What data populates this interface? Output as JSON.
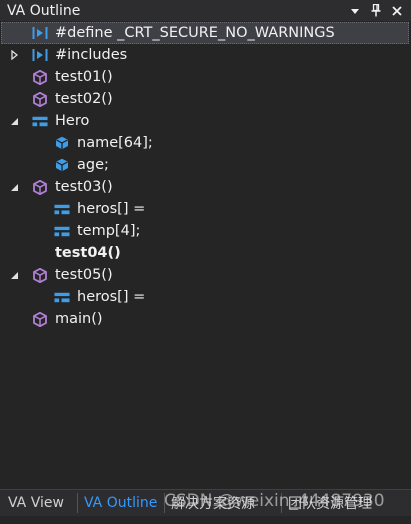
{
  "window": {
    "title": "VA Outline",
    "controls": [
      "dropdown-icon",
      "pin-icon",
      "close-icon"
    ]
  },
  "tree": [
    {
      "label": "#define _CRT_SECURE_NO_WARNINGS",
      "icon": "define-icon",
      "expander": "none",
      "selected": true
    },
    {
      "label": "#includes",
      "icon": "define-icon",
      "expander": "collapsed"
    },
    {
      "label": "test01()",
      "icon": "method-icon",
      "expander": "none"
    },
    {
      "label": "test02()",
      "icon": "method-icon",
      "expander": "none"
    },
    {
      "label": "Hero",
      "icon": "struct-icon",
      "expander": "expanded"
    },
    {
      "label": "name[64];",
      "icon": "field-icon",
      "expander": "none"
    },
    {
      "label": "age;",
      "icon": "field-icon",
      "expander": "none"
    },
    {
      "label": "test03()",
      "icon": "method-icon",
      "expander": "expanded"
    },
    {
      "label": "heros[] =",
      "icon": "struct-icon",
      "expander": "none"
    },
    {
      "label": "temp[4];",
      "icon": "struct-icon",
      "expander": "none"
    },
    {
      "label": "test04()",
      "icon": "none",
      "expander": "none",
      "bold": true
    },
    {
      "label": "test05()",
      "icon": "method-icon",
      "expander": "expanded"
    },
    {
      "label": "heros[] =",
      "icon": "struct-icon",
      "expander": "none"
    },
    {
      "label": "main()",
      "icon": "method-icon",
      "expander": "none"
    }
  ],
  "tabs": [
    {
      "label": "VA View",
      "active": false
    },
    {
      "label": "VA Outline",
      "active": true
    },
    {
      "label": "解决方案资源",
      "active": false
    },
    {
      "label": "团队资源管理",
      "active": false
    }
  ],
  "watermark": "CSDN @weixin_44487930",
  "colors": {
    "background": "#252526",
    "titlebar": "#2d2d30",
    "selection": "#3f3f46",
    "activeTab": "#3399ff",
    "methodIcon": "#b180d7",
    "structIcon": "#3d9de8",
    "fieldIcon": "#3d9de8"
  }
}
